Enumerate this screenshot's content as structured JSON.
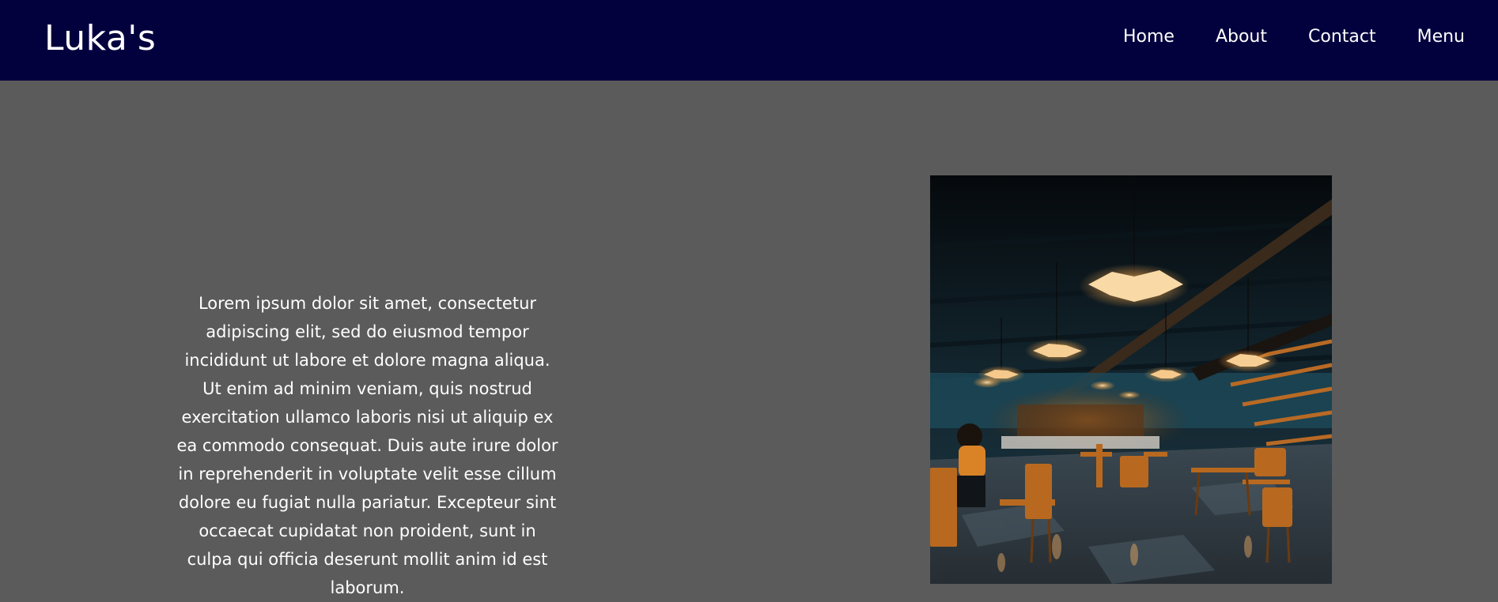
{
  "navbar": {
    "brand": "Luka's",
    "links": [
      {
        "label": "Home"
      },
      {
        "label": "About"
      },
      {
        "label": "Contact"
      },
      {
        "label": "Menu"
      }
    ]
  },
  "main": {
    "intro_text": "Lorem ipsum dolor sit amet, consectetur adipiscing elit, sed do eiusmod tempor incididunt ut labore et dolore magna aliqua. Ut enim ad minim veniam, quis nostrud exercitation ullamco laboris nisi ut aliquip ex ea commodo consequat. Duis aute irure dolor in reprehenderit in voluptate velit esse cillum dolore eu fugiat nulla pariatur. Excepteur sint occaecat cupidatat non proident, sunt in culpa qui officia deserunt mollit anim id est laborum.",
    "photo": {
      "subject": "restaurant interior with hanging lamps and wooden chairs"
    }
  },
  "colors": {
    "navbar_bg": "#03003e",
    "page_bg": "#5b5b5b",
    "text": "#ffffff"
  }
}
